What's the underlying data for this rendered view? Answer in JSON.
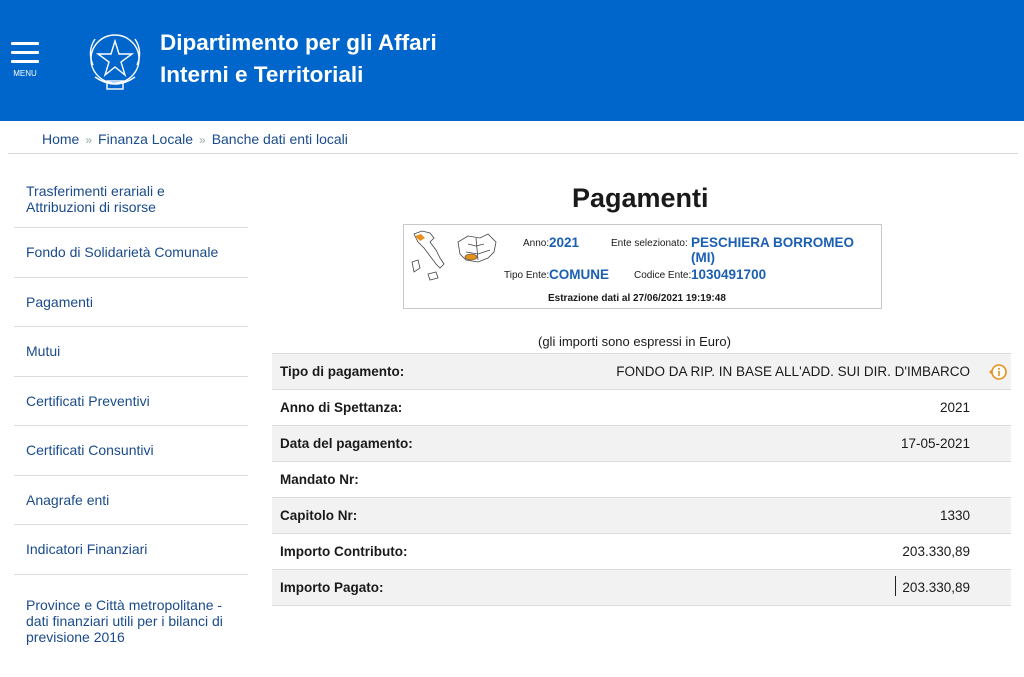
{
  "header": {
    "menu_label": "MENU",
    "title_line1": "Dipartimento per gli Affari",
    "title_line2": "Interni e Territoriali"
  },
  "breadcrumb": [
    "Home",
    "Finanza Locale",
    "Banche dati enti locali"
  ],
  "sidebar": {
    "items": [
      {
        "label": "Trasferimenti erariali e Attribuzioni di risorse"
      },
      {
        "label": "Fondo di Solidarietà Comunale"
      },
      {
        "label": "Pagamenti"
      },
      {
        "label": "Mutui"
      },
      {
        "label": "Certificati Preventivi"
      },
      {
        "label": "Certificati Consuntivi"
      },
      {
        "label": "Anagrafe enti"
      },
      {
        "label": "Indicatori Finanziari"
      },
      {
        "label": "Province e Città metropolitane - dati finanziari utili per i bilanci di previsione 2016"
      }
    ]
  },
  "page_title": "Pagamenti",
  "infobox": {
    "anno_label": "Anno:",
    "anno_value": "2021",
    "ente_label": "Ente selezionato:",
    "ente_value": "PESCHIERA BORROMEO (MI)",
    "tipo_label": "Tipo Ente:",
    "tipo_value": "COMUNE",
    "codice_label": "Codice Ente:",
    "codice_value": "1030491700",
    "estrazione": "Estrazione dati al 27/06/2021 19:19:48"
  },
  "note": "(gli importi sono espressi in Euro)",
  "table": {
    "rows": [
      {
        "label": "Tipo di pagamento:",
        "value": "FONDO DA RIP. IN BASE ALL'ADD. SUI DIR. D'IMBARCO"
      },
      {
        "label": "Anno di Spettanza:",
        "value": "2021"
      },
      {
        "label": "Data del pagamento:",
        "value": "17-05-2021"
      },
      {
        "label": "Mandato Nr:",
        "value": ""
      },
      {
        "label": "Capitolo Nr:",
        "value": "1330"
      },
      {
        "label": "Importo Contributo:",
        "value": "203.330,89"
      },
      {
        "label": "Importo Pagato:",
        "value": "203.330,89"
      }
    ]
  },
  "colors": {
    "header_bg": "#0066cc",
    "link": "#1a4b8c",
    "accent_orange": "#e8901c"
  },
  "icons": {
    "menu": "hamburger-icon",
    "emblem": "republic-emblem-icon",
    "info": "info-icon",
    "map": "italy-map-icon"
  }
}
